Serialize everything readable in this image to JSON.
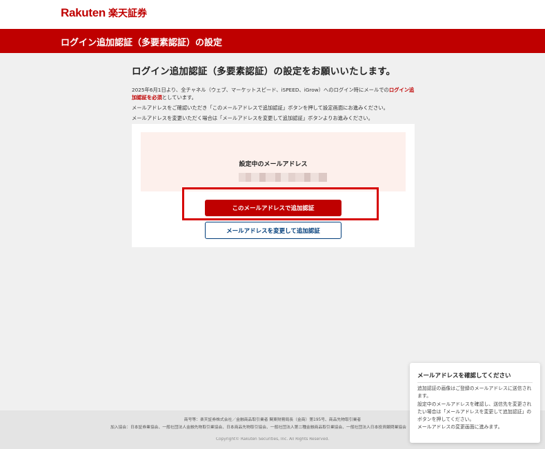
{
  "brand": {
    "logo_en": "Rakuten",
    "logo_ja": "楽天証券",
    "color": "#bf0000"
  },
  "header": {
    "title": "ログイン追加認証（多要素認証）の設定"
  },
  "main": {
    "title": "ログイン追加認証（多要素認証）の設定をお願いいたします。",
    "para1_pre": "2025年6月1日より、全チャネル（ウェブ、マーケットスピード、iSPEED、iGrow）へのログイン時にメールでの",
    "para1_em": "ログイン追加認証を必須",
    "para1_post": "としています。",
    "para2": "メールアドレスをご確認いただき「このメールアドレスで追加認証」ボタンを押して設定画面にお進みください。",
    "para3": "メールアドレスを変更いただく場合は「メールアドレスを変更して追加認証」ボタンよりお進みください。"
  },
  "card": {
    "email_label": "設定中のメールアドレス",
    "primary_button": "このメールアドレスで追加認証",
    "secondary_button": "メールアドレスを変更して追加認証"
  },
  "footer": {
    "line1": "商号等：楽天証券株式会社／金融商品取引業者 関東財務局長（金商）第195号、商品先物取引業者",
    "line2": "加入協会：日本証券業協会、一般社団法人金融先物取引業協会、日本商品先物取引協会、一般社団法人第二種金融商品取引業協会、一般社団法人日本投資顧問業協会",
    "copyright": "Copyright© Rakuten Securities, Inc. All Rights Reserved."
  },
  "toast": {
    "title": "メールアドレスを確認してください",
    "body1": "追加認証の画像はご登録のメールアドレスに送信されます。",
    "body2": "設定中のメールアドレスを確認し、送信先を変更されたい場合は「メールアドレスを変更して追加認証」のボタンを押してください。",
    "body3": "メールアドレスの変更画面に進みます。"
  },
  "colors": {
    "accent": "#bf0000",
    "highlight_border": "#d60000",
    "secondary_button": "#003d7a",
    "email_box_bg": "#fdf0ec"
  }
}
